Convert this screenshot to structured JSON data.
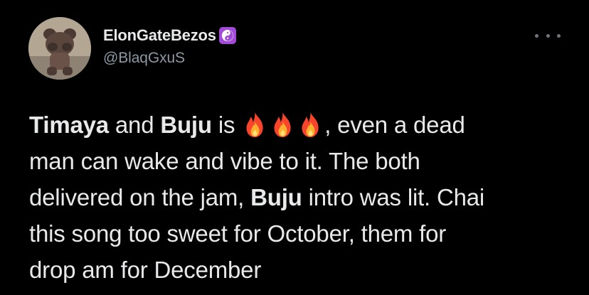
{
  "user": {
    "display_name": "ElonGateBezos",
    "badge_emoji": "☯",
    "handle": "@BlaqGxuS"
  },
  "tweet": {
    "w1": "Timaya",
    "t1": " and ",
    "w2": "Buju",
    "t2": " is ",
    "fire_emoji": "🔥",
    "t3": ", even a dead",
    "line2": "man can wake and vibe to it. The both",
    "line3a": "delivered on the jam, ",
    "w3": "Buju",
    "line3b": " intro was lit. Chai",
    "line4": "this song too sweet for October, them for",
    "line5": "drop am for December"
  },
  "colors": {
    "background": "#000000",
    "text": "#e7e9ea",
    "secondary": "#8b98a5",
    "badge": "#a34bd9"
  },
  "icons": {
    "more": "more-horizontal-icon",
    "badge": "yin-yang-icon",
    "emoji": "fire-icon"
  }
}
